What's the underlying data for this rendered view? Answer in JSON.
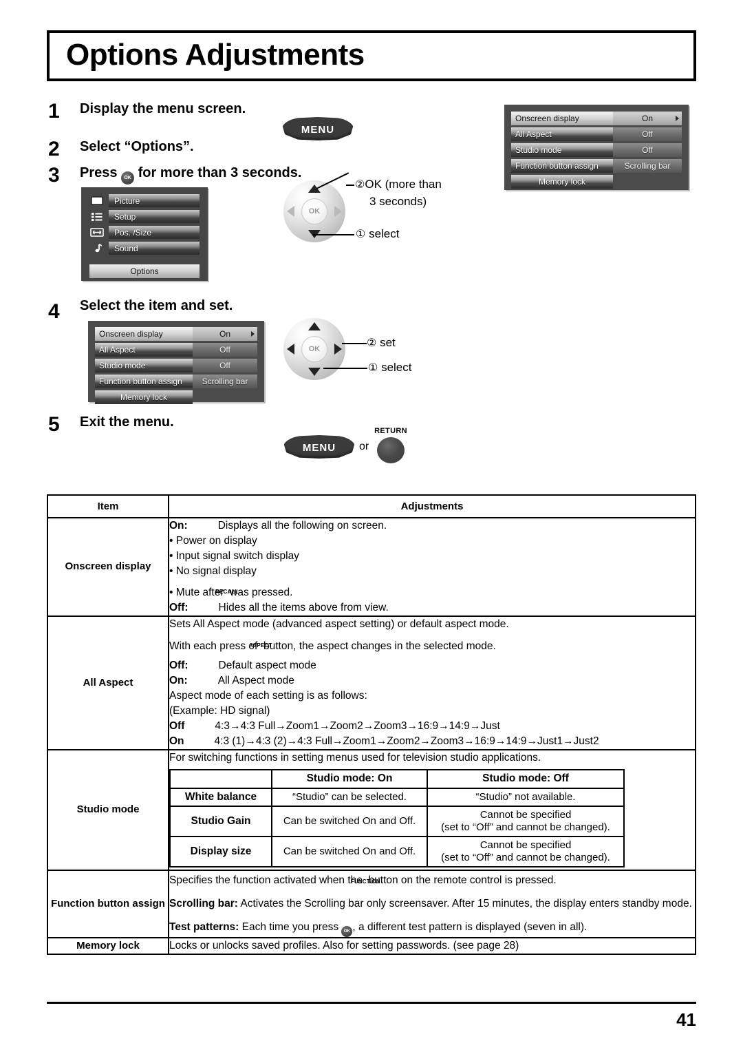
{
  "page": {
    "title": "Options Adjustments",
    "number": "41"
  },
  "steps": [
    {
      "num": "1",
      "text": "Display the menu screen."
    },
    {
      "num": "2",
      "text": "Select “Options”."
    },
    {
      "num": "3",
      "text_before": "Press",
      "icon": "ok-button-icon",
      "text_after": "for more than 3 seconds."
    },
    {
      "num": "4",
      "text": "Select the item and set."
    },
    {
      "num": "5",
      "text": "Exit the menu."
    }
  ],
  "buttons": {
    "menu_label": "MENU",
    "return_label": "RETURN",
    "or_label": "or",
    "ok_label": "OK",
    "recall_label": "RECALL",
    "aspect_label": "ASPECT",
    "function_label": "FUNCTION"
  },
  "options_menu": {
    "rows": [
      {
        "label": "Onscreen display",
        "value": "On",
        "selected": true,
        "has_arrow": true
      },
      {
        "label": "All Aspect",
        "value": "Off",
        "selected": false,
        "has_arrow": false
      },
      {
        "label": "Studio mode",
        "value": "Off",
        "selected": false,
        "has_arrow": false
      },
      {
        "label": "Function button assign",
        "value": "Scrolling bar",
        "selected": false,
        "has_arrow": false
      },
      {
        "label": "Memory lock",
        "value": "",
        "selected": false,
        "has_arrow": false
      }
    ]
  },
  "main_menu": {
    "items": [
      {
        "label": "Picture",
        "icon": "picture-icon"
      },
      {
        "label": "Setup",
        "icon": "setup-icon"
      },
      {
        "label": "Pos. /Size",
        "icon": "pos-size-icon"
      },
      {
        "label": "Sound",
        "icon": "sound-icon"
      }
    ],
    "options_label": "Options"
  },
  "callouts": {
    "step3": [
      {
        "num": "②",
        "text": "OK (more than",
        "text2": "3 seconds)"
      },
      {
        "num": "①",
        "text": "select"
      }
    ],
    "step4": [
      {
        "num": "②",
        "text": "set"
      },
      {
        "num": "①",
        "text": "select"
      }
    ]
  },
  "table": {
    "headers": {
      "item": "Item",
      "adjustments": "Adjustments"
    },
    "rows": [
      {
        "item": "Onscreen display",
        "lines": [
          {
            "bold": "On:",
            "text": "Displays all the following on screen."
          },
          {
            "bullet": "• Power on display"
          },
          {
            "bullet": "• Input signal switch display"
          },
          {
            "bullet": "• No signal display"
          },
          {
            "bullet_icon": "• Mute after",
            "icon": "recall-button-icon",
            "after": "was pressed."
          },
          {
            "bold": "Off:",
            "text": "Hides all the items above from view."
          }
        ]
      },
      {
        "item": "All Aspect",
        "lines": [
          {
            "text": "Sets All Aspect mode (advanced aspect setting) or default aspect mode."
          },
          {
            "text_before": "With each press of",
            "icon": "aspect-button-icon",
            "text_after": "button, the aspect changes in the selected mode."
          },
          {
            "bold": "Off:",
            "text": "Default aspect mode"
          },
          {
            "bold": "On:",
            "text": "All Aspect mode"
          },
          {
            "text": "Aspect mode of each setting is as follows:"
          },
          {
            "text": "(Example: HD signal)"
          },
          {
            "bold": "Off",
            "text": "4:3→4:3 Full→Zoom1→Zoom2→Zoom3→16:9→14:9→Just"
          },
          {
            "bold": "On",
            "text": "4:3 (1)→4:3 (2)→4:3 Full→Zoom1→Zoom2→Zoom3→16:9→14:9→Just1→Just2"
          }
        ]
      },
      {
        "item": "Studio mode",
        "intro": "For switching functions in setting menus used for television studio applications.",
        "subtable": {
          "col_headers": [
            "",
            "Studio mode: On",
            "Studio mode: Off"
          ],
          "rows": [
            {
              "name": "White balance",
              "on": "“Studio” can be selected.",
              "off": "“Studio” not available.",
              "off2": ""
            },
            {
              "name": "Studio Gain",
              "on": "Can be switched On and Off.",
              "off": "Cannot be specified",
              "off2": "(set to “Off” and cannot be changed)."
            },
            {
              "name": "Display size",
              "on": "Can be switched On and Off.",
              "off": "Cannot be specified",
              "off2": "(set to “Off” and cannot be changed)."
            }
          ]
        }
      },
      {
        "item": "Function button assign",
        "lines": [
          {
            "text_before": "Specifies the function activated when the",
            "icon": "function-button-icon",
            "text_after": "button on the remote control is pressed."
          },
          {
            "bold": "Scrolling bar:",
            "text": "Activates the Scrolling bar only screensaver. After 15 minutes, the display enters standby mode."
          },
          {
            "bold": "Test patterns:",
            "text_before": "Each time you press",
            "icon": "ok-button-icon",
            "text_after": ", a different test pattern is displayed (seven in all)."
          }
        ]
      },
      {
        "item": "Memory lock",
        "lines": [
          {
            "text": "Locks or unlocks saved profiles. Also for setting passwords. (see page 28)"
          }
        ]
      }
    ]
  }
}
